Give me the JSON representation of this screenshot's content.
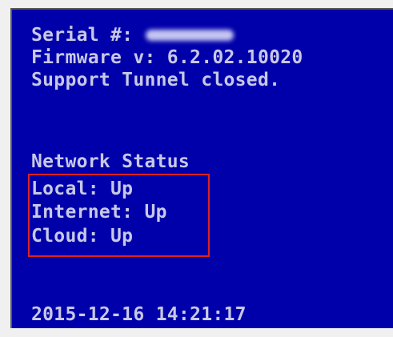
{
  "console": {
    "serial_label": "Serial #: ",
    "firmware": "Firmware v: 6.2.02.10020",
    "support": "Support Tunnel closed.",
    "network_status_heading": "Network Status",
    "local": "Local: Up",
    "internet": "Internet: Up",
    "cloud": "Cloud: Up",
    "datetime": "2015-12-16 14:21:17"
  },
  "colors": {
    "background": "#0000aa",
    "text": "#c8c8e6",
    "highlight": "#e02020"
  }
}
